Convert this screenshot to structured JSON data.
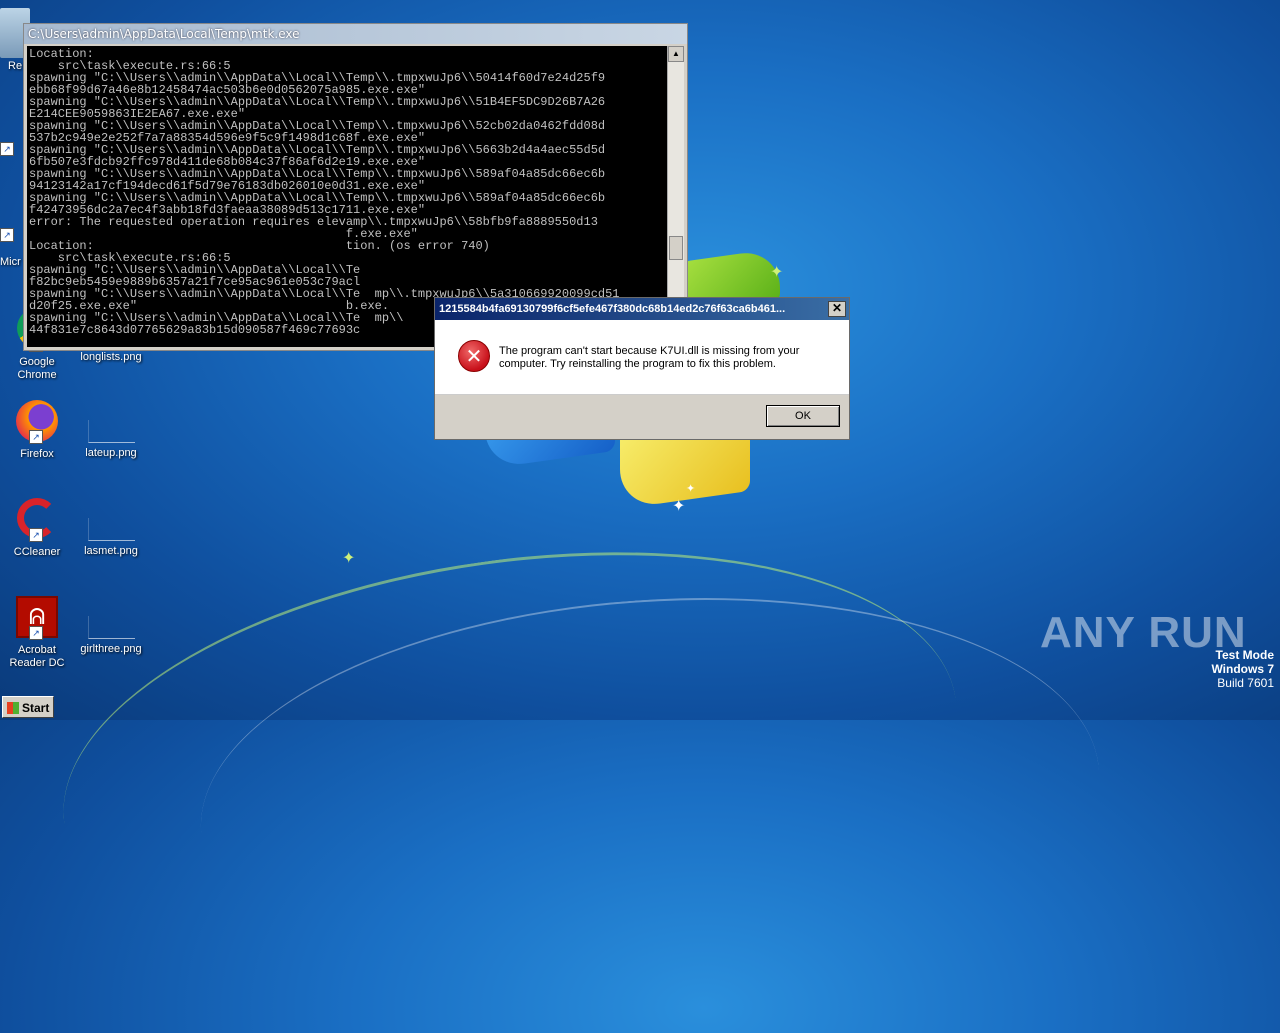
{
  "console": {
    "title": "C:\\Users\\admin\\AppData\\Local\\Temp\\mtk.exe",
    "lines": [
      "Location:",
      "    src\\task\\execute.rs:66:5",
      "spawning \"C:\\\\Users\\\\admin\\\\AppData\\\\Local\\\\Temp\\\\.tmpxwuJp6\\\\50414f60d7e24d25f9",
      "ebb68f99d67a46e8b12458474ac503b6e0d0562075a985.exe.exe\"",
      "spawning \"C:\\\\Users\\\\admin\\\\AppData\\\\Local\\\\Temp\\\\.tmpxwuJp6\\\\51B4EF5DC9D26B7A26",
      "E214CEE9059863IE2EA67.exe.exe\"",
      "spawning \"C:\\\\Users\\\\admin\\\\AppData\\\\Local\\\\Temp\\\\.tmpxwuJp6\\\\52cb02da0462fdd08d",
      "537b2c949e2e252f7a7a88354d596e9f5c9f1498d1c68f.exe.exe\"",
      "spawning \"C:\\\\Users\\\\admin\\\\AppData\\\\Local\\\\Temp\\\\.tmpxwuJp6\\\\5663b2d4a4aec55d5d",
      "6fb507e3fdcb92ffc978d411de68b084c37f86af6d2e19.exe.exe\"",
      "spawning \"C:\\\\Users\\\\admin\\\\AppData\\\\Local\\\\Temp\\\\.tmpxwuJp6\\\\589af04a85dc66ec6b",
      "94123142a17cf194decd61f5d79e76183db026010e0d31.exe.exe\"",
      "spawning \"C:\\\\Users\\\\admin\\\\AppData\\\\Local\\\\Temp\\\\.tmpxwuJp6\\\\589af04a85dc66ec6b",
      "f42473956dc2a7ec4f3abb18fd3faeaa38089d513c1711.exe.exe\"",
      "error: The requested operation requires elevamp\\\\.tmpxwuJp6\\\\58bfb9fa8889550d13",
      "                                            f.exe.exe\"",
      "Location:                                   tion. (os error 740)",
      "    src\\task\\execute.rs:66:5",
      "spawning \"C:\\\\Users\\\\admin\\\\AppData\\\\Local\\\\Te",
      "f82bc9eb5459e9889b6357a21f7ce95ac961e053c79acl",
      "spawning \"C:\\\\Users\\\\admin\\\\AppData\\\\Local\\\\Te  mp\\\\.tmpxwuJp6\\\\5a310669920099cd51",
      "d20f25.exe.exe\"                             b.exe.",
      "spawning \"C:\\\\Users\\\\admin\\\\AppData\\\\Local\\\\Te  mp\\\\",
      "44f831e7c8643d07765629a83b15d090587f469c77693c"
    ]
  },
  "dialog": {
    "title": "1215584b4fa69130799f6cf5efe467f380dc68b14ed2c76f63ca6b461...",
    "message": "The program can't start because K7UI.dll is missing from your computer. Try reinstalling the program to fix this problem.",
    "ok_label": "OK",
    "close_glyph": "✕",
    "icon": "error-icon"
  },
  "desktop_icons": [
    {
      "label": "Google Chrome",
      "icon": "chrome-icon"
    },
    {
      "label": "longlists.png",
      "icon": "png-file-icon"
    },
    {
      "label": "Firefox",
      "icon": "firefox-icon"
    },
    {
      "label": "lateup.png",
      "icon": "png-file-icon"
    },
    {
      "label": "CCleaner",
      "icon": "ccleaner-icon"
    },
    {
      "label": "lasmet.png",
      "icon": "png-file-icon"
    },
    {
      "label": "Acrobat Reader DC",
      "icon": "acrobat-icon"
    },
    {
      "label": "girlthree.png",
      "icon": "png-file-icon"
    }
  ],
  "partial_labels": {
    "recycle": "Re",
    "micro": "Micr"
  },
  "watermark": "ANY RUN",
  "os_info": {
    "line1": "Test Mode",
    "line2": "Windows 7",
    "line3": "Build 7601"
  },
  "taskbar": {
    "start_label": "Start"
  }
}
